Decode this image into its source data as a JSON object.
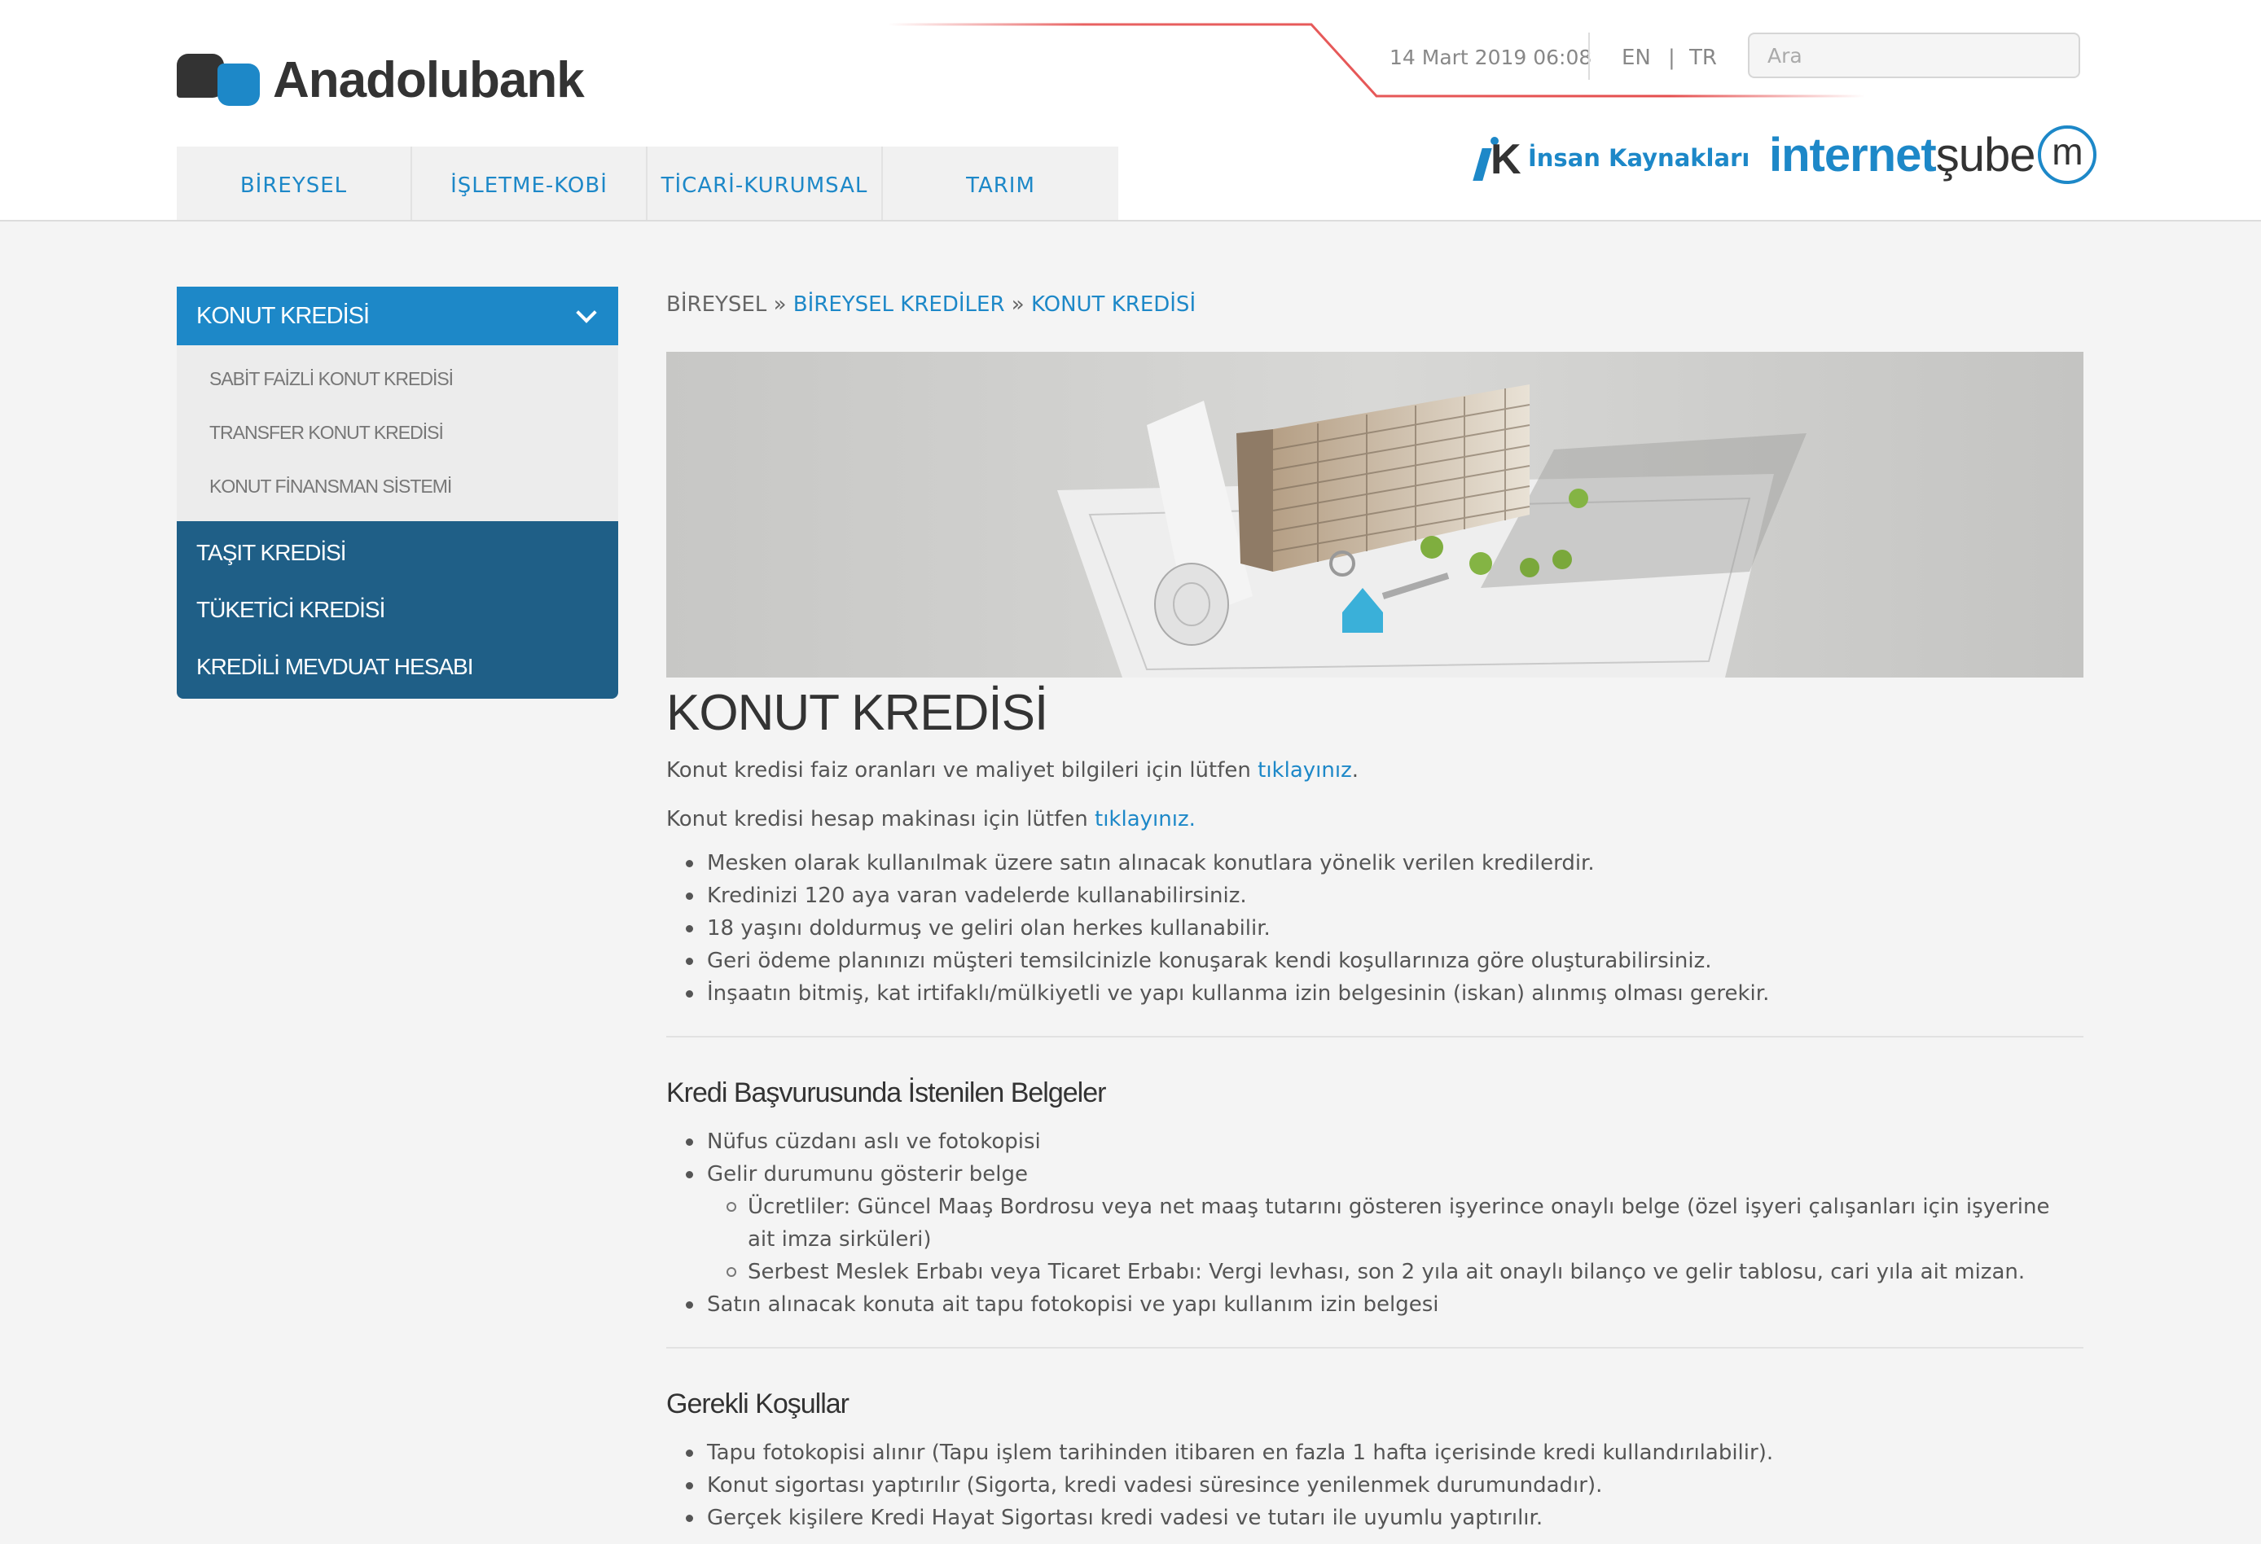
{
  "brand": {
    "name": "Anadolubank",
    "accent": "#1d88c8",
    "dark_blue": "#1f5f87"
  },
  "topbar": {
    "date": "14 Mart 2019 06:08",
    "lang_en": "EN",
    "lang_sep": "|",
    "lang_tr": "TR",
    "search_placeholder": "Ara"
  },
  "nav": [
    "BİREYSEL",
    "İŞLETME-KOBİ",
    "TİCARİ-KURUMSAL",
    "TARIM"
  ],
  "ik": {
    "mark": "K",
    "label": "İnsan Kaynakları"
  },
  "internet_sube": {
    "part1": "internet",
    "part2": "şube",
    "badge": "m"
  },
  "sidebar": {
    "active": "KONUT KREDİSİ",
    "sub_items": [
      "SABİT FAİZLİ KONUT KREDİSİ",
      "TRANSFER KONUT KREDİSİ",
      "KONUT FİNANSMAN SİSTEMİ"
    ],
    "items": [
      "TAŞIT KREDİSİ",
      "TÜKETİCİ KREDİSİ",
      "KREDİLİ MEVDUAT HESABI"
    ]
  },
  "breadcrumb": {
    "root": "BİREYSEL",
    "sep": "»",
    "level2": "BİREYSEL KREDİLER",
    "level3": "KONUT KREDİSİ"
  },
  "page": {
    "title": "KONUT KREDİSİ",
    "lead1_text": "Konut kredisi faiz oranları ve maliyet bilgileri için lütfen ",
    "lead1_link": "tıklayınız",
    "lead1_end": ".",
    "lead2_text": "Konut kredisi hesap makinası için lütfen ",
    "lead2_link": "tıklayınız.",
    "bullets": [
      "Mesken olarak kullanılmak üzere satın alınacak konutlara yönelik verilen kredilerdir.",
      "Kredinizi 120 aya varan vadelerde kullanabilirsiniz.",
      "18 yaşını doldurmuş ve geliri olan herkes kullanabilir.",
      "Geri ödeme planınızı müşteri temsilcinizle konuşarak kendi koşullarınıza göre oluşturabilirsiniz.",
      "İnşaatın bitmiş, kat irtifaklı/mülkiyetli ve yapı kullanma izin belgesinin (iskan) alınmış olması gerekir."
    ],
    "docs_title": "Kredi Başvurusunda İstenilen Belgeler",
    "docs": {
      "item1": "Nüfus cüzdanı aslı ve fotokopisi",
      "item2": "Gelir durumunu gösterir belge",
      "sub1": "Ücretliler: Güncel Maaş Bordrosu veya net maaş tutarını gösteren işyerince onaylı belge (özel işyeri çalışanları için işyerine ait imza sirküleri)",
      "sub2": "Serbest Meslek Erbabı veya Ticaret Erbabı: Vergi levhası, son 2 yıla ait onaylı bilanço ve gelir tablosu, cari yıla ait mizan.",
      "item3": "Satın alınacak konuta ait tapu fotokopisi ve yapı kullanım izin belgesi"
    },
    "conditions_title": "Gerekli Koşullar",
    "conditions": [
      "Tapu fotokopisi alınır (Tapu işlem tarihinden itibaren en fazla 1 hafta içerisinde kredi kullandırılabilir).",
      "Konut sigortası yaptırılır (Sigorta, kredi vadesi süresince yenilenmek durumundadır).",
      "Gerçek kişilere Kredi Hayat Sigortası kredi vadesi ve tutarı ile uyumlu yaptırılır."
    ]
  }
}
